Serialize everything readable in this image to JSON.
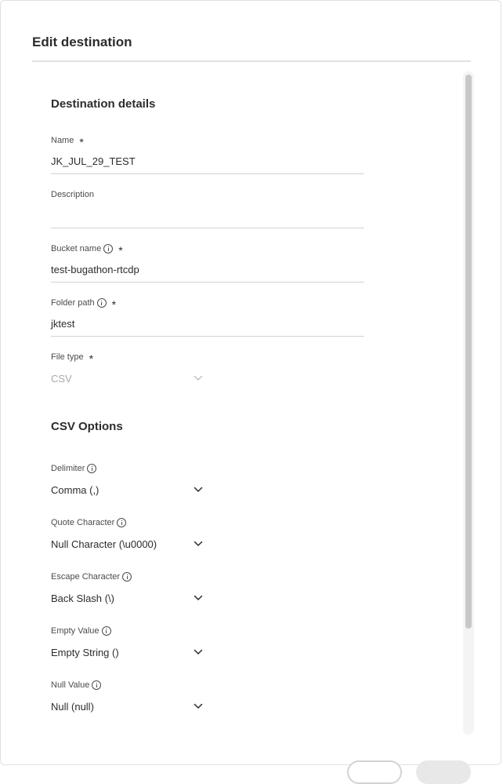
{
  "dialog": {
    "title": "Edit destination"
  },
  "sections": {
    "destination_details": "Destination details",
    "csv_options": "CSV Options"
  },
  "fields": {
    "name": {
      "label": "Name",
      "value": "JK_JUL_29_TEST",
      "required": "*"
    },
    "description": {
      "label": "Description",
      "value": ""
    },
    "bucket_name": {
      "label": "Bucket name",
      "value": "test-bugathon-rtcdp",
      "required": "*"
    },
    "folder_path": {
      "label": "Folder path",
      "value": "jktest",
      "required": "*"
    },
    "file_type": {
      "label": "File type",
      "value": "CSV",
      "required": "*"
    }
  },
  "csv_options": {
    "delimiter": {
      "label": "Delimiter",
      "value": "Comma (,)"
    },
    "quote_character": {
      "label": "Quote Character",
      "value": "Null Character (\\u0000)"
    },
    "escape_character": {
      "label": "Escape Character",
      "value": "Back Slash (\\)"
    },
    "empty_value": {
      "label": "Empty Value",
      "value": "Empty String ()"
    },
    "null_value": {
      "label": "Null Value",
      "value": "Null (null)"
    }
  },
  "icons": {
    "info": "info-icon",
    "dropdown": "chevron-down-icon"
  },
  "colors": {
    "text": "#2c2c2c",
    "disabled_text": "#a8a8a8",
    "divider": "#e1e1e1",
    "underline": "#d3d3d3"
  }
}
